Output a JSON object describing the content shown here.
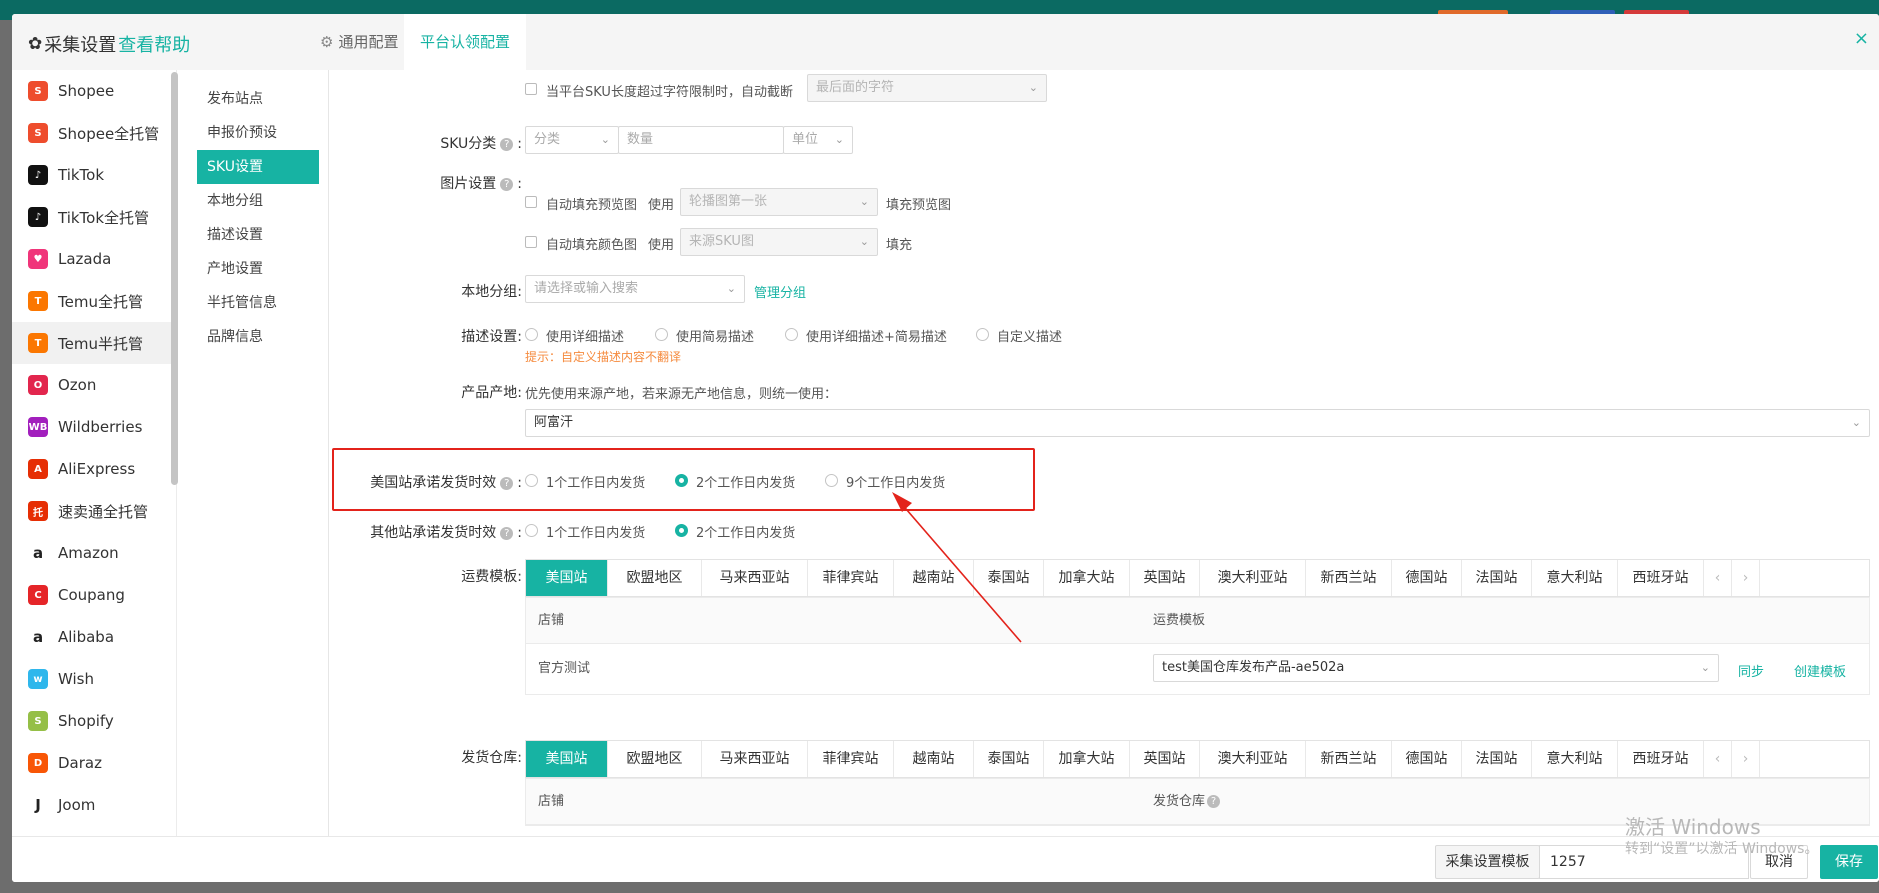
{
  "header": {
    "title": "采集设置",
    "help": "查看帮助",
    "tabs": [
      {
        "label": "通用配置"
      },
      {
        "label": "平台认领配置"
      }
    ],
    "close": "×"
  },
  "platforms": [
    {
      "name": "Shopee",
      "color": "#ee4d2d",
      "glyph": "S"
    },
    {
      "name": "Shopee全托管",
      "color": "#ee4d2d",
      "glyph": "S"
    },
    {
      "name": "TikTok",
      "color": "#111111",
      "glyph": "♪"
    },
    {
      "name": "TikTok全托管",
      "color": "#111111",
      "glyph": "♪"
    },
    {
      "name": "Lazada",
      "color": "#f0357a",
      "glyph": "♥"
    },
    {
      "name": "Temu全托管",
      "color": "#fb7701",
      "glyph": "T"
    },
    {
      "name": "Temu半托管",
      "color": "#fb7701",
      "glyph": "T"
    },
    {
      "name": "Ozon",
      "color": "#e2264d",
      "glyph": "O"
    },
    {
      "name": "Wildberries",
      "color": "#a21fbd",
      "glyph": "WB"
    },
    {
      "name": "AliExpress",
      "color": "#e62e04",
      "glyph": "A"
    },
    {
      "name": "速卖通全托管",
      "color": "#e62e04",
      "glyph": "托"
    },
    {
      "name": "Amazon",
      "color": "#ffffff",
      "glyph": "a"
    },
    {
      "name": "Coupang",
      "color": "#e52528",
      "glyph": "C"
    },
    {
      "name": "Alibaba",
      "color": "#ffffff",
      "glyph": "a"
    },
    {
      "name": "Wish",
      "color": "#2fb7ec",
      "glyph": "w"
    },
    {
      "name": "Shopify",
      "color": "#95bf47",
      "glyph": "S"
    },
    {
      "name": "Daraz",
      "color": "#f85606",
      "glyph": "D"
    },
    {
      "name": "Joom",
      "color": "#ffffff",
      "glyph": "J"
    }
  ],
  "selected_platform": "Temu半托管",
  "sections": [
    "发布站点",
    "申报价预设",
    "SKU设置",
    "本地分组",
    "描述设置",
    "产地设置",
    "半托管信息",
    "品牌信息"
  ],
  "selected_section": "SKU设置",
  "form": {
    "truncate": {
      "label": "当平台SKU长度超过字符限制时，自动截断",
      "select": "最后面的字符"
    },
    "sku_class": {
      "label": "SKU分类",
      "category": "分类",
      "quantity": "数量",
      "unit": "单位"
    },
    "image": {
      "label": "图片设置",
      "row1": {
        "check": "自动填充预览图",
        "use": "使用",
        "select": "轮播图第一张",
        "tail": "填充预览图"
      },
      "row2": {
        "check": "自动填充颜色图",
        "use": "使用",
        "select": "来源SKU图",
        "tail": "填充"
      }
    },
    "group": {
      "label": "本地分组",
      "placeholder": "请选择或输入搜索",
      "manage": "管理分组"
    },
    "desc": {
      "label": "描述设置",
      "options": [
        "使用详细描述",
        "使用简易描述",
        "使用详细描述+简易描述",
        "自定义描述"
      ],
      "hint": "提示：自定义描述内容不翻译"
    },
    "origin": {
      "label": "产品产地",
      "note": "优先使用来源产地，若来源无产地信息，则统一使用：",
      "value": "阿富汗"
    },
    "us_ship": {
      "label": "美国站承诺发货时效",
      "options": [
        "1个工作日内发货",
        "2个工作日内发货",
        "9个工作日内发货"
      ],
      "selected": 1
    },
    "other_ship": {
      "label": "其他站承诺发货时效",
      "options": [
        "1个工作日内发货",
        "2个工作日内发货"
      ],
      "selected": 1
    },
    "freight": {
      "label": "运费模板",
      "col_store": "店铺",
      "col_tpl": "运费模板",
      "store": "官方测试",
      "template": "test美国仓库发布产品-ae502a",
      "sync": "同步",
      "create": "创建模板"
    },
    "warehouse": {
      "label": "发货仓库",
      "col_store": "店铺",
      "col_wh": "发货仓库"
    }
  },
  "site_tabs": [
    "美国站",
    "欧盟地区",
    "马来西亚站",
    "菲律宾站",
    "越南站",
    "泰国站",
    "加拿大站",
    "英国站",
    "澳大利亚站",
    "新西兰站",
    "德国站",
    "法国站",
    "意大利站",
    "西班牙站"
  ],
  "footer": {
    "template_btn": "采集设置模板",
    "template_value": "1257",
    "cancel": "取消",
    "save": "保存"
  },
  "watermark": {
    "line1": "激活 Windows",
    "line2": "转到“设置”以激活 Windows。"
  },
  "accent": "#17b3a3"
}
